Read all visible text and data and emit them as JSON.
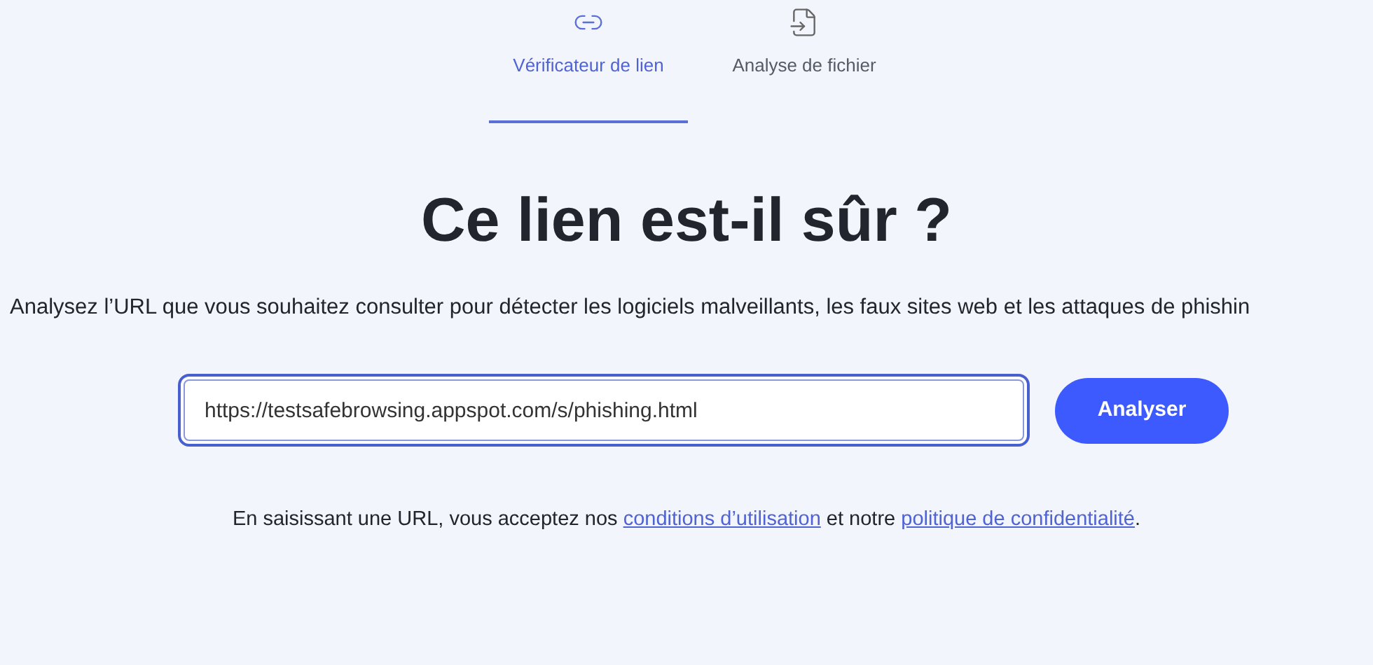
{
  "tabs": [
    {
      "label": "Vérificateur de lien",
      "selected": true
    },
    {
      "label": "Analyse de fichier",
      "selected": false
    }
  ],
  "title": "Ce lien est-il sûr ?",
  "subtitle": "Analysez l’URL que vous souhaitez consulter pour détecter les logiciels malveillants, les faux sites web et les attaques de phishin",
  "url_field": {
    "value": "https://testsafebrowsing.appspot.com/s/phishing.html"
  },
  "submit_button": "Analyser",
  "terms": {
    "before": "En saisissant une URL, vous acceptez nos",
    "link_1": "conditions d’utilisation",
    "middle": "et notre",
    "link_2": "politique de confidentialité",
    "after": "."
  }
}
